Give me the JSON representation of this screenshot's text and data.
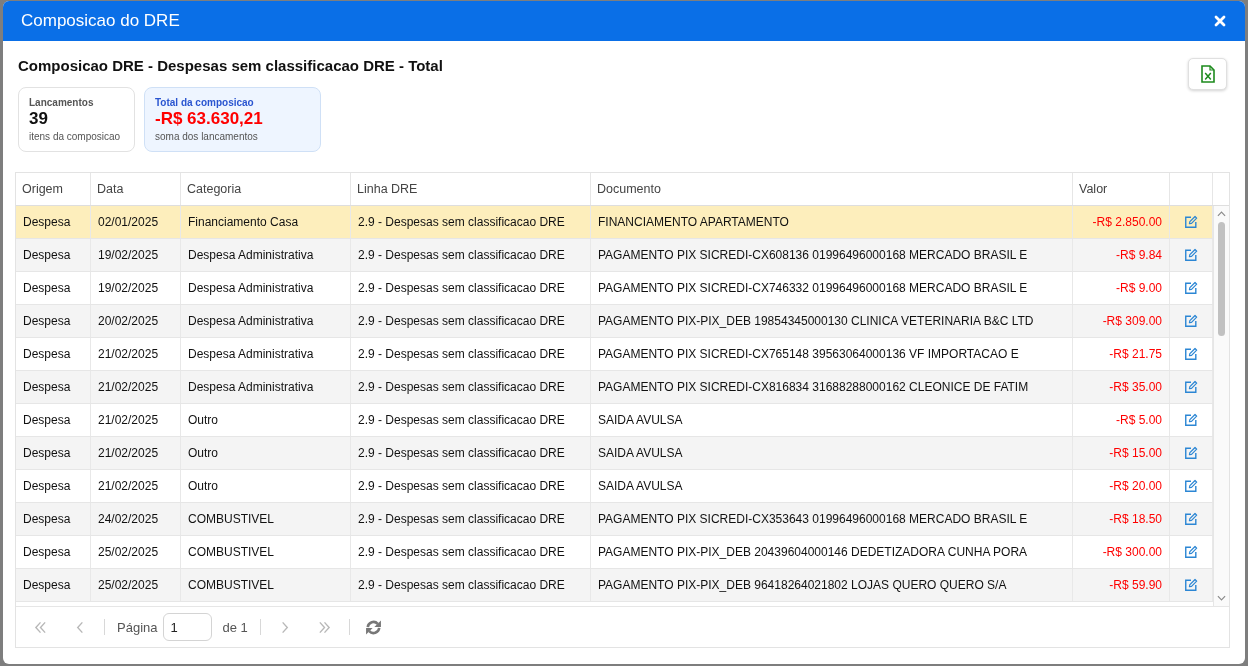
{
  "window": {
    "title": "Composicao do DRE"
  },
  "heading": "Composicao DRE - Despesas sem classificacao DRE - Total",
  "summary_cards": [
    {
      "label": "Lancamentos",
      "value": "39",
      "caption": "itens da composicao",
      "highlighted": false
    },
    {
      "label": "Total da composicao",
      "value": "-R$ 63.630,21",
      "caption": "soma dos lancamentos",
      "highlighted": true
    }
  ],
  "table": {
    "columns": [
      {
        "label": "Origem",
        "kind": "text"
      },
      {
        "label": "Data",
        "kind": "text"
      },
      {
        "label": "Categoria",
        "kind": "text"
      },
      {
        "label": "Linha DRE",
        "kind": "text"
      },
      {
        "label": "Documento",
        "kind": "text"
      },
      {
        "label": "Valor",
        "kind": "money"
      }
    ],
    "rows": [
      {
        "cells": [
          "Despesa",
          "02/01/2025",
          "Financiamento Casa",
          "2.9 - Despesas sem classificacao DRE",
          "FINANCIAMENTO APARTAMENTO",
          "-R$ 2.850.00"
        ],
        "selected": true
      },
      {
        "cells": [
          "Despesa",
          "19/02/2025",
          "Despesa Administrativa",
          "2.9 - Despesas sem classificacao DRE",
          "PAGAMENTO PIX SICREDI-CX608136 01996496000168 MERCADO BRASIL E",
          "-R$ 9.84"
        ],
        "selected": false
      },
      {
        "cells": [
          "Despesa",
          "19/02/2025",
          "Despesa Administrativa",
          "2.9 - Despesas sem classificacao DRE",
          "PAGAMENTO PIX SICREDI-CX746332 01996496000168 MERCADO BRASIL E",
          "-R$ 9.00"
        ],
        "selected": false
      },
      {
        "cells": [
          "Despesa",
          "20/02/2025",
          "Despesa Administrativa",
          "2.9 - Despesas sem classificacao DRE",
          "PAGAMENTO PIX-PIX_DEB 19854345000130 CLINICA VETERINARIA B&C LTD",
          "-R$ 309.00"
        ],
        "selected": false
      },
      {
        "cells": [
          "Despesa",
          "21/02/2025",
          "Despesa Administrativa",
          "2.9 - Despesas sem classificacao DRE",
          "PAGAMENTO PIX SICREDI-CX765148 39563064000136 VF IMPORTACAO E",
          "-R$ 21.75"
        ],
        "selected": false
      },
      {
        "cells": [
          "Despesa",
          "21/02/2025",
          "Despesa Administrativa",
          "2.9 - Despesas sem classificacao DRE",
          "PAGAMENTO PIX SICREDI-CX816834 31688288000162 CLEONICE DE FATIM",
          "-R$ 35.00"
        ],
        "selected": false
      },
      {
        "cells": [
          "Despesa",
          "21/02/2025",
          "Outro",
          "2.9 - Despesas sem classificacao DRE",
          "SAIDA AVULSA",
          "-R$ 5.00"
        ],
        "selected": false
      },
      {
        "cells": [
          "Despesa",
          "21/02/2025",
          "Outro",
          "2.9 - Despesas sem classificacao DRE",
          "SAIDA AVULSA",
          "-R$ 15.00"
        ],
        "selected": false
      },
      {
        "cells": [
          "Despesa",
          "21/02/2025",
          "Outro",
          "2.9 - Despesas sem classificacao DRE",
          "SAIDA AVULSA",
          "-R$ 20.00"
        ],
        "selected": false
      },
      {
        "cells": [
          "Despesa",
          "24/02/2025",
          "COMBUSTIVEL",
          "2.9 - Despesas sem classificacao DRE",
          "PAGAMENTO PIX SICREDI-CX353643 01996496000168 MERCADO BRASIL E",
          "-R$ 18.50"
        ],
        "selected": false
      },
      {
        "cells": [
          "Despesa",
          "25/02/2025",
          "COMBUSTIVEL",
          "2.9 - Despesas sem classificacao DRE",
          "PAGAMENTO PIX-PIX_DEB 20439604000146 DEDETIZADORA CUNHA PORA",
          "-R$ 300.00"
        ],
        "selected": false
      },
      {
        "cells": [
          "Despesa",
          "25/02/2025",
          "COMBUSTIVEL",
          "2.9 - Despesas sem classificacao DRE",
          "PAGAMENTO PIX-PIX_DEB 96418264021802 LOJAS QUERO QUERO S/A",
          "-R$ 59.90"
        ],
        "selected": false
      }
    ]
  },
  "pager": {
    "items": [
      {
        "kind": "first",
        "disabled": true
      },
      {
        "kind": "prev",
        "disabled": true
      },
      {
        "kind": "separator"
      },
      {
        "kind": "label",
        "text": "Página"
      },
      {
        "kind": "input",
        "value": "1"
      },
      {
        "kind": "label",
        "text": "de 1"
      },
      {
        "kind": "separator"
      },
      {
        "kind": "next",
        "disabled": true
      },
      {
        "kind": "last",
        "disabled": true
      },
      {
        "kind": "separator"
      },
      {
        "kind": "refresh",
        "disabled": false
      }
    ]
  }
}
